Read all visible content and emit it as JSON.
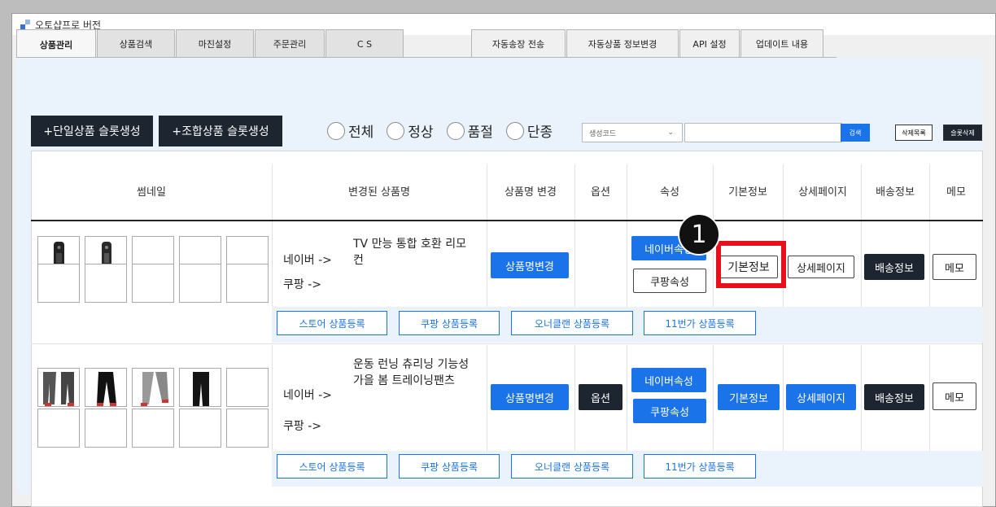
{
  "window": {
    "title": "오토샵프로 버전"
  },
  "tabs": [
    "상품관리",
    "상품검색",
    "마진설정",
    "주문관리",
    "C S"
  ],
  "right_tabs": [
    "자동송장 전송",
    "자동상품 정보변경",
    "API 설정",
    "업데이트 내용"
  ],
  "toolbar": {
    "single_btn": "+단일상품 슬롯생성",
    "combo_btn": "+조합상품 슬롯생성",
    "radios": [
      "전체",
      "정상",
      "품절",
      "단종"
    ],
    "select_value": "생성코드",
    "search_btn": "검색",
    "delete_list_btn": "삭제목록",
    "slot_delete_btn": "슬롯삭제"
  },
  "headers": {
    "thumb": "썸네일",
    "name": "변경된 상품명",
    "name_change": "상품명 변경",
    "option": "옵션",
    "attr": "속성",
    "basic": "기본정보",
    "detail": "상세페이지",
    "shipping": "배송정보",
    "memo": "메모"
  },
  "rows": [
    {
      "naver_label": "네이버 ->",
      "naver_name": "TV 만능 통합 호환 리모컨",
      "coupang_label": "쿠팡 ->",
      "name_change_btn": "상품명변경",
      "naver_attr_btn": "네이버속성",
      "coupang_attr_btn": "쿠팡속성",
      "basic_btn": "기본정보",
      "detail_btn": "상세페이지",
      "shipping_btn": "배송정보",
      "memo_btn": "메모",
      "reg": [
        "스토어 상품등록",
        "쿠팡 상품등록",
        "오너클랜 상품등록",
        "11번가 상품등록"
      ]
    },
    {
      "naver_label": "네이버 ->",
      "naver_name": "운동 런닝 츄리닝 기능성 가을 봄 트레이닝팬츠",
      "coupang_label": "쿠팡 ->",
      "name_change_btn": "상품명변경",
      "option_btn": "옵션",
      "naver_attr_btn": "네이버속성",
      "coupang_attr_btn": "쿠팡속성",
      "basic_btn": "기본정보",
      "detail_btn": "상세페이지",
      "shipping_btn": "배송정보",
      "memo_btn": "메모",
      "reg": [
        "스토어 상품등록",
        "쿠팡 상품등록",
        "오너클랜 상품등록",
        "11번가 상품등록"
      ]
    }
  ],
  "annotation": {
    "step": "1"
  },
  "colors": {
    "primary": "#1a73e8",
    "dark": "#1d2530",
    "highlight": "#e8101b",
    "content_bg": "#eaf3fb"
  }
}
